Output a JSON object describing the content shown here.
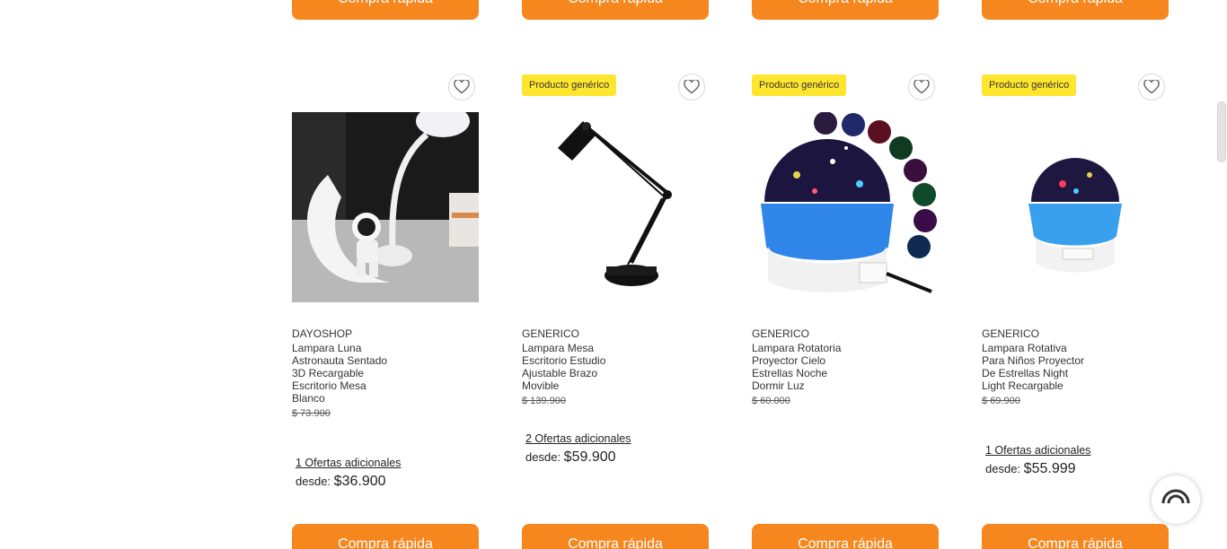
{
  "quick_buy_label": "Compra rápida",
  "badge_label": "Producto genérico",
  "products": [
    {
      "brand": "DAYOSHOP",
      "title": "Lampara Luna Astronauta Sentado 3D Recargable Escritorio Mesa Blanco",
      "old_price": "$ 73.900",
      "offers": "1 Ofertas adicionales",
      "from_label": "desde:",
      "price": "$36.900"
    },
    {
      "brand": "GENERICO",
      "title": "Lampara Mesa Escritorio Estudio Ajustable Brazo Movible",
      "old_price": "$ 139.900",
      "offers": "2 Ofertas adicionales",
      "from_label": "desde:",
      "price": "$59.900"
    },
    {
      "brand": "GENERICO",
      "title": "Lampara Rotatoria Proyector Cielo Estrellas Noche Dormir Luz",
      "old_price": "$ 60.000"
    },
    {
      "brand": "GENERICO",
      "title": "Lampara Rotativa Para Niños Proyector De Estrellas Night Light Recargable",
      "old_price": "$ 69.900",
      "offers": "1 Ofertas adicionales",
      "from_label": "desde:",
      "price": "$55.999"
    }
  ],
  "colors": {
    "accent": "#f6871f",
    "badge": "#ffe62e"
  }
}
